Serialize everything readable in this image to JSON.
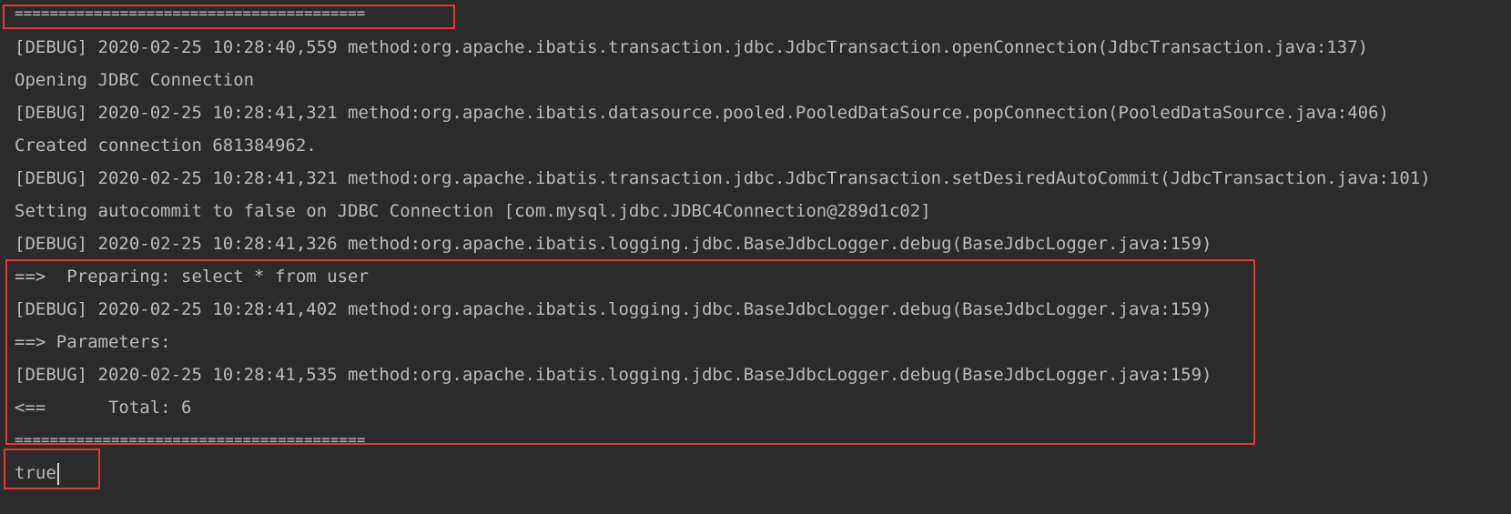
{
  "console": {
    "lines": [
      "========================================",
      "[DEBUG] 2020-02-25 10:28:40,559 method:org.apache.ibatis.transaction.jdbc.JdbcTransaction.openConnection(JdbcTransaction.java:137)",
      "Opening JDBC Connection",
      "[DEBUG] 2020-02-25 10:28:41,321 method:org.apache.ibatis.datasource.pooled.PooledDataSource.popConnection(PooledDataSource.java:406)",
      "Created connection 681384962.",
      "[DEBUG] 2020-02-25 10:28:41,321 method:org.apache.ibatis.transaction.jdbc.JdbcTransaction.setDesiredAutoCommit(JdbcTransaction.java:101)",
      "Setting autocommit to false on JDBC Connection [com.mysql.jdbc.JDBC4Connection@289d1c02]",
      "[DEBUG] 2020-02-25 10:28:41,326 method:org.apache.ibatis.logging.jdbc.BaseJdbcLogger.debug(BaseJdbcLogger.java:159)",
      "==>  Preparing: select * from user",
      "[DEBUG] 2020-02-25 10:28:41,402 method:org.apache.ibatis.logging.jdbc.BaseJdbcLogger.debug(BaseJdbcLogger.java:159)",
      "==> Parameters: ",
      "[DEBUG] 2020-02-25 10:28:41,535 method:org.apache.ibatis.logging.jdbc.BaseJdbcLogger.debug(BaseJdbcLogger.java:159)",
      "<==      Total: 6",
      "========================================",
      "true"
    ]
  },
  "colors": {
    "background": "#2b2b2b",
    "text": "#bbbbbb",
    "highlight_box": "#e0383e"
  }
}
